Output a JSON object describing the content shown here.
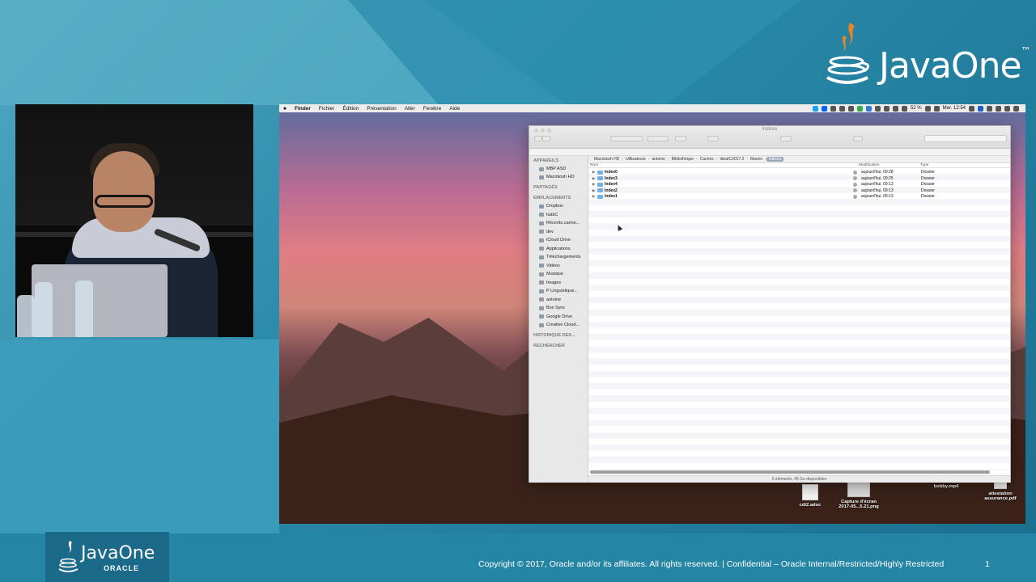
{
  "slide": {
    "brand_top": "JavaOne",
    "brand_bottom": "JavaOne",
    "brand_bottom_sub": "ORACLE",
    "footer": "Copyright © 2017, Oracle and/or its affiliates. All rights reserved.  |  Confidential – Oracle Internal/Restricted/Highly Restricted",
    "page_number": "1"
  },
  "menubar": {
    "apple": "",
    "items": [
      "Finder",
      "Fichier",
      "Édition",
      "Présentation",
      "Aller",
      "Fenêtre",
      "Aide"
    ],
    "battery": "52 %",
    "clock": "Mer. 12:54"
  },
  "finder": {
    "title": "indices",
    "sidebar": {
      "appareils_header": "APPAREILS",
      "appareils": [
        "MBP ASD",
        "Macintosh HD"
      ],
      "partages_header": "PARTAGÉS",
      "emplacements_header": "EMPLACEMENTS",
      "emplacements": [
        "Dropbox",
        "hubiC",
        "Récents.canne...",
        "dev",
        "iCloud Drive",
        "Applications",
        "Téléchargements",
        "Vidéos",
        "Musique",
        "Images",
        "P Linguistique...",
        "antoine",
        "Box Sync",
        "Google Drive",
        "Creative Cloud..."
      ],
      "historique_header": "HISTORIQUE DES...",
      "rechercher_header": "RECHERCHER"
    },
    "path": [
      "Macintosh HD",
      "Utilisateurs",
      "antoine",
      "Bibliothèque",
      "Caches",
      "IdeaIC2017.2",
      "Maven",
      "indices"
    ],
    "columns": {
      "name": "Nom",
      "modified": "Modification",
      "type": "Type"
    },
    "rows": [
      {
        "name": "Index0",
        "modified": "aujourd'hui, 09:28",
        "type": "Dossier"
      },
      {
        "name": "Index3",
        "modified": "aujourd'hui, 09:25",
        "type": "Dossier"
      },
      {
        "name": "Index4",
        "modified": "aujourd'hui, 09:13",
        "type": "Dossier"
      },
      {
        "name": "Index2",
        "modified": "aujourd'hui, 09:13",
        "type": "Dossier"
      },
      {
        "name": "Index1",
        "modified": "aujourd'hui, 09:13",
        "type": "Dossier"
      }
    ],
    "status": "5 éléments, 45 Go disponibles"
  },
  "desktop": {
    "icons": [
      "cdi2.adoc",
      "Capture d'écran 2017-05...5.21.png",
      "bobby.mp4",
      "attestation assurance.pdf"
    ]
  },
  "colors": {
    "slide_bg": "#1f7f9e",
    "selection": "#9aa7b8",
    "folder": "#6fb1e6"
  }
}
